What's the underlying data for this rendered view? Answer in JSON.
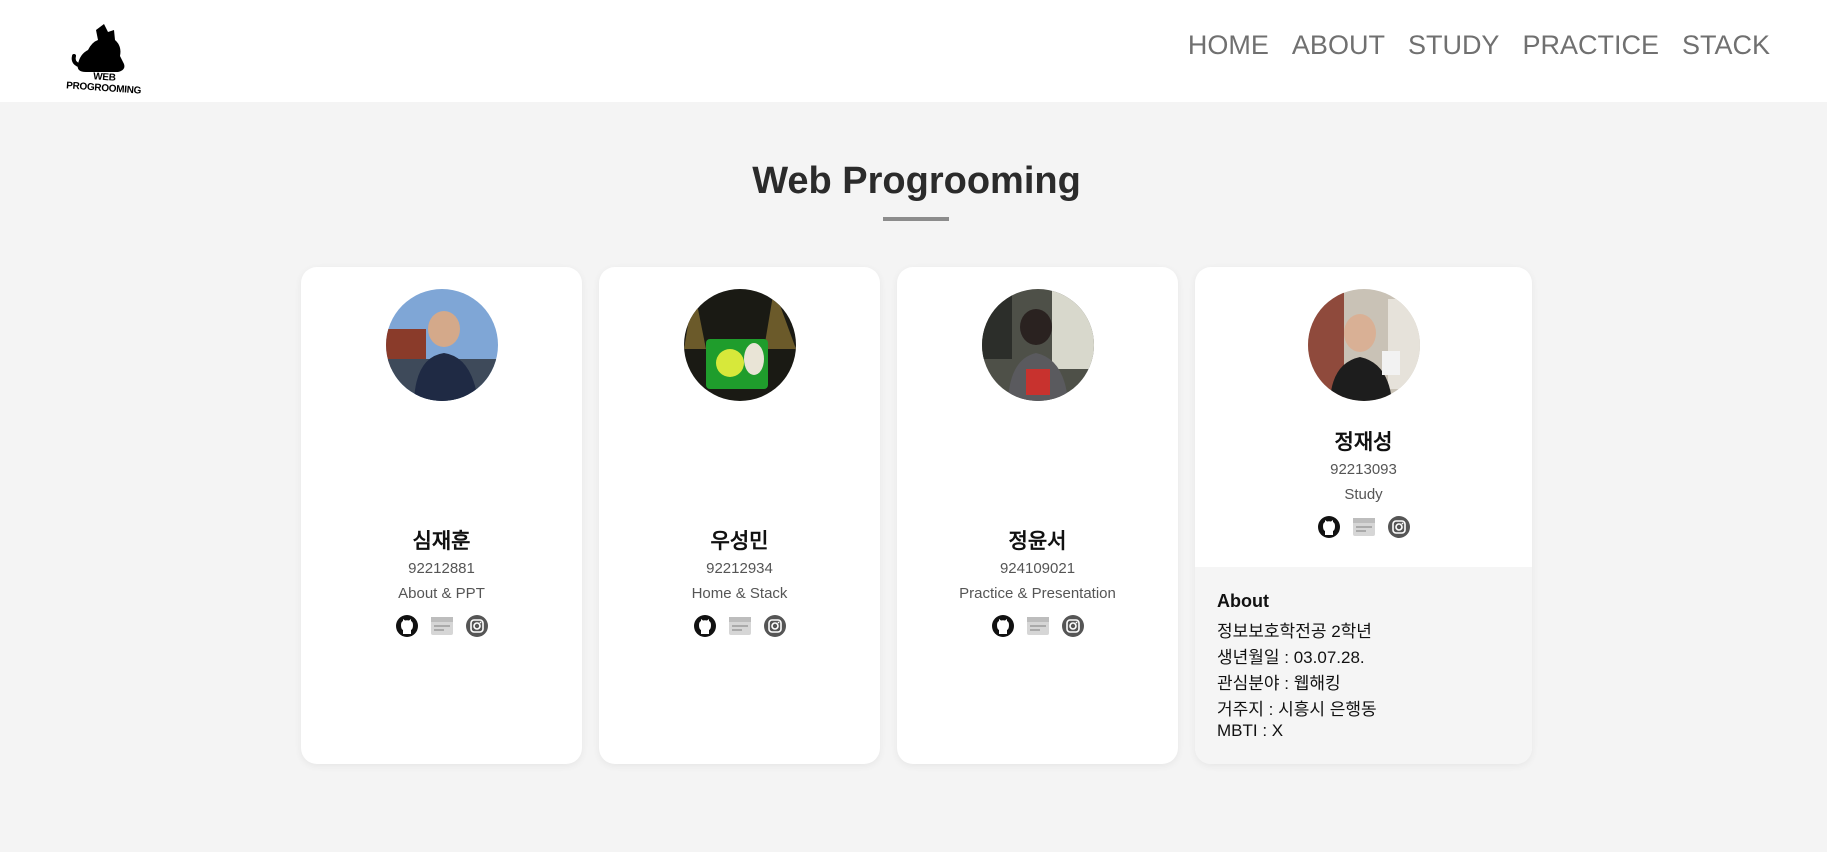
{
  "header": {
    "logo_text": "WEB PROGROOMING",
    "nav": [
      {
        "label": "HOME"
      },
      {
        "label": "ABOUT"
      },
      {
        "label": "STUDY"
      },
      {
        "label": "PRACTICE"
      },
      {
        "label": "STACK"
      }
    ]
  },
  "main": {
    "title": "Web Progrooming"
  },
  "members": [
    {
      "name": "심재훈",
      "id": "92212881",
      "role": "About & PPT",
      "icons": [
        "github-icon",
        "blog-icon",
        "instagram-icon"
      ]
    },
    {
      "name": "우성민",
      "id": "92212934",
      "role": "Home & Stack",
      "icons": [
        "github-icon",
        "blog-icon",
        "instagram-icon"
      ]
    },
    {
      "name": "정윤서",
      "id": "924109021",
      "role": "Practice & Presentation",
      "icons": [
        "github-icon",
        "blog-icon",
        "instagram-icon"
      ]
    },
    {
      "name": "정재성",
      "id": "92213093",
      "role": "Study",
      "icons": [
        "github-icon",
        "blog-icon",
        "instagram-icon"
      ],
      "about": {
        "title": "About",
        "lines": [
          "정보보호학전공 2학년",
          "생년월일 : 03.07.28.",
          "관심분야 : 웹해킹",
          "거주지 : 시흥시 은행동",
          "MBTI : X"
        ]
      }
    }
  ],
  "colors": {
    "background": "#f4f4f4",
    "card": "#ffffff",
    "nav_text": "#707070",
    "underline": "#8c8c8c",
    "about_panel": "#f5f5f5"
  }
}
